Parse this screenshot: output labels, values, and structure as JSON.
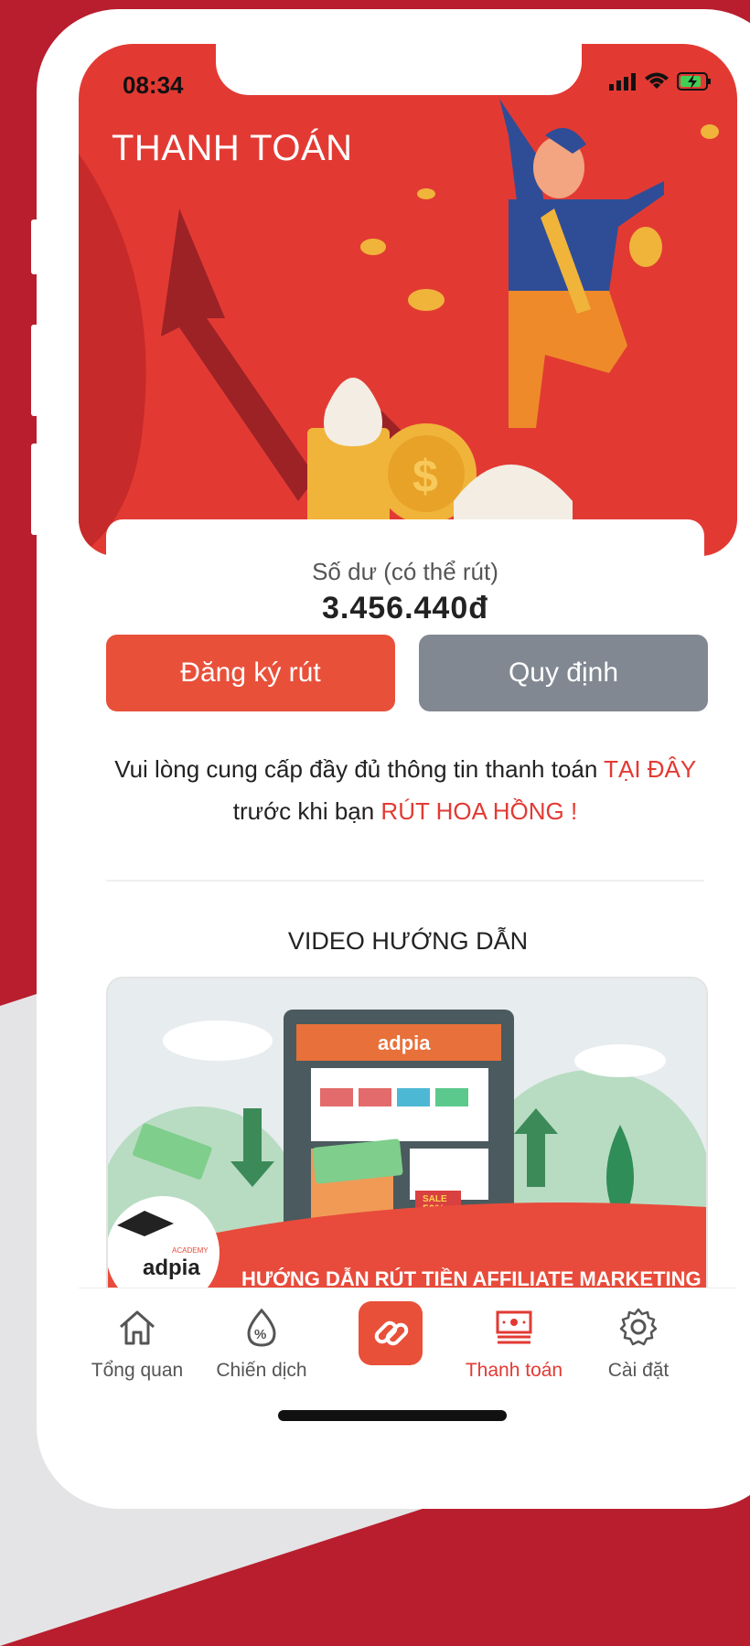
{
  "status": {
    "time": "08:34"
  },
  "header": {
    "title": "THANH TOÁN"
  },
  "balance": {
    "label": "Số dư (có thể rút)",
    "value": "3.456.440đ"
  },
  "actions": {
    "withdraw_label": "Đăng ký rút",
    "rules_label": "Quy định"
  },
  "info": {
    "part1": "Vui lòng cung cấp đầy đủ thông tin thanh toán ",
    "link": "TẠI ĐÂY",
    "part2": " trước khi bạn ",
    "emphasis": "RÚT HOA HỒNG !"
  },
  "video": {
    "section_title": "VIDEO HƯỚNG DẪN",
    "thumbnail_caption": "HƯỚNG DẪN RÚT TIỀN AFFILIATE MARKETING",
    "brand_text": "adpia",
    "academy_text": "ACADEMY",
    "sale_text": "SALE",
    "discount_text": "-50%"
  },
  "tabs": [
    {
      "label": "Tổng quan",
      "icon": "home-icon"
    },
    {
      "label": "Chiến dịch",
      "icon": "percent-drop-icon"
    },
    {
      "label": "",
      "icon": "link-icon"
    },
    {
      "label": "Thanh toán",
      "icon": "payment-icon"
    },
    {
      "label": "Cài đặt",
      "icon": "gear-icon"
    }
  ],
  "colors": {
    "primary": "#e23a33",
    "button_red": "#e8503a",
    "button_gray": "#828891",
    "frame": "#b81e2e"
  }
}
